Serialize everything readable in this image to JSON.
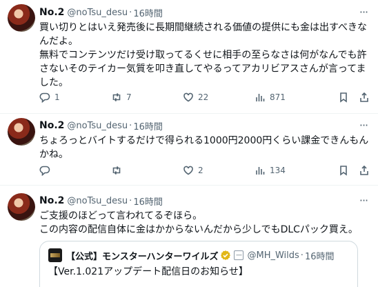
{
  "tweets": [
    {
      "name": "No.2",
      "handle": "@noTsu_desu",
      "time": "16時間",
      "text": "買い切りとはいえ発売後に長期間継続される価値の提供にも金は出すべきなんだよ。\n無料でコンテンツだけ受け取ってるくせに相手の至らなさは何がなんでも許さないそのテイカー気質を叩き直してやるってアカリビアスさんが言ってました。",
      "replies": "1",
      "retweets": "7",
      "likes": "22",
      "views": "871"
    },
    {
      "name": "No.2",
      "handle": "@noTsu_desu",
      "time": "16時間",
      "text": "ちょろっとバイトするだけで得られる1000円2000円くらい課金できんもんかね。",
      "replies": "",
      "retweets": "",
      "likes": "2",
      "views": "134"
    },
    {
      "name": "No.2",
      "handle": "@noTsu_desu",
      "time": "16時間",
      "text": "ご支援のほどって言われてるぞほら。\nこの内容の配信自体に金はかからないんだから少しでもDLCパック買え。",
      "quote": {
        "name": "【公式】モンスターハンターワイルズ",
        "handle": "@MH_Wilds",
        "time": "16時間",
        "text": "【Ver.1.021アップデート配信日のお知らせ】"
      }
    }
  ],
  "sep": "·",
  "colors": {
    "text": "#0f1419",
    "muted": "#536471",
    "border": "#eff3f4",
    "verified": "#e2b719"
  }
}
